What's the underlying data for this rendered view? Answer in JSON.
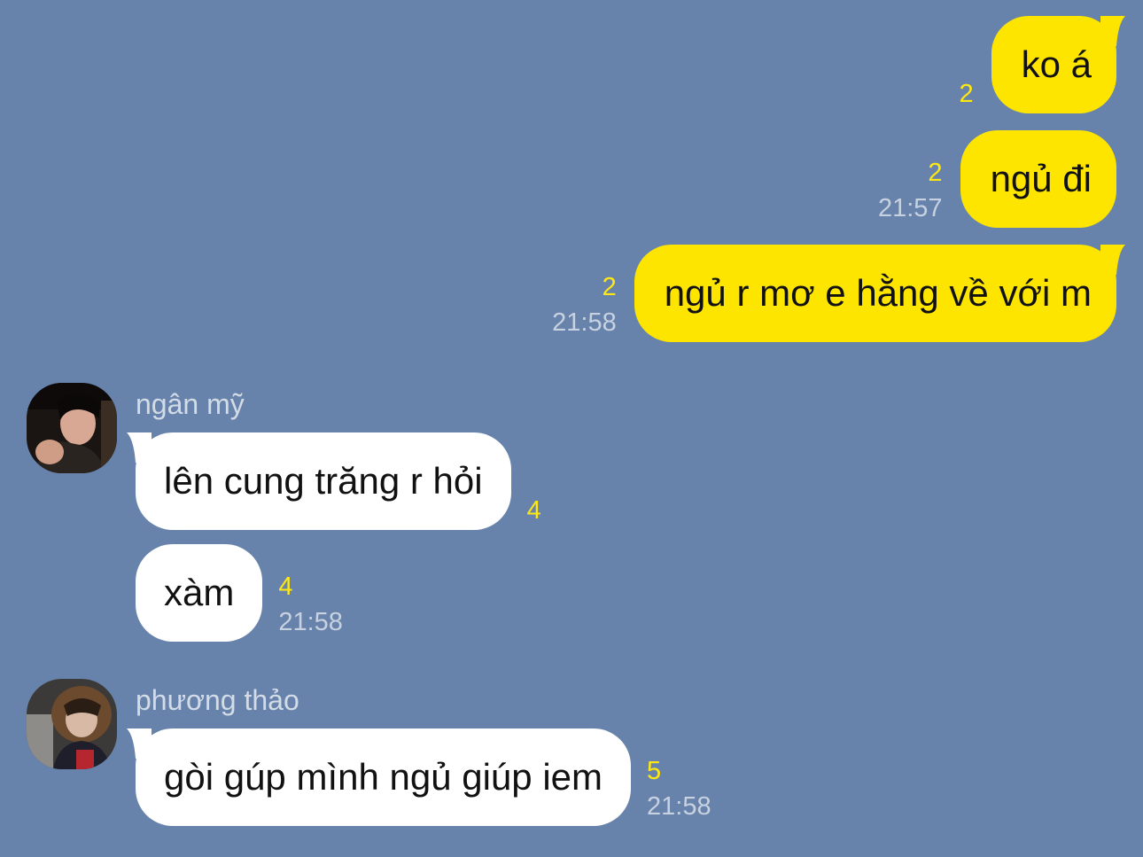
{
  "colors": {
    "background": "#6783ab",
    "sent_bubble": "#fee500",
    "received_bubble": "#ffffff",
    "unread_count": "#ffe812",
    "timestamp": "#c7d1e0",
    "sender_name": "#d3dbe7"
  },
  "messages_sent": [
    {
      "text": "ko á",
      "unread": "2",
      "time": ""
    },
    {
      "text": "ngủ đi",
      "unread": "2",
      "time": "21:57"
    },
    {
      "text": "ngủ r mơ e hằng về với m",
      "unread": "2",
      "time": "21:58"
    }
  ],
  "groups": [
    {
      "sender": "ngân mỹ",
      "avatar_icon": "profile-photo-icon",
      "messages": [
        {
          "text": "lên cung trăng r hỏi",
          "unread": "4",
          "time": ""
        },
        {
          "text": "xàm",
          "unread": "4",
          "time": "21:58"
        }
      ]
    },
    {
      "sender": "phương thảo",
      "avatar_icon": "profile-photo-icon",
      "messages": [
        {
          "text": "gòi gúp mình ngủ giúp iem",
          "unread": "5",
          "time": "21:58"
        }
      ]
    }
  ]
}
